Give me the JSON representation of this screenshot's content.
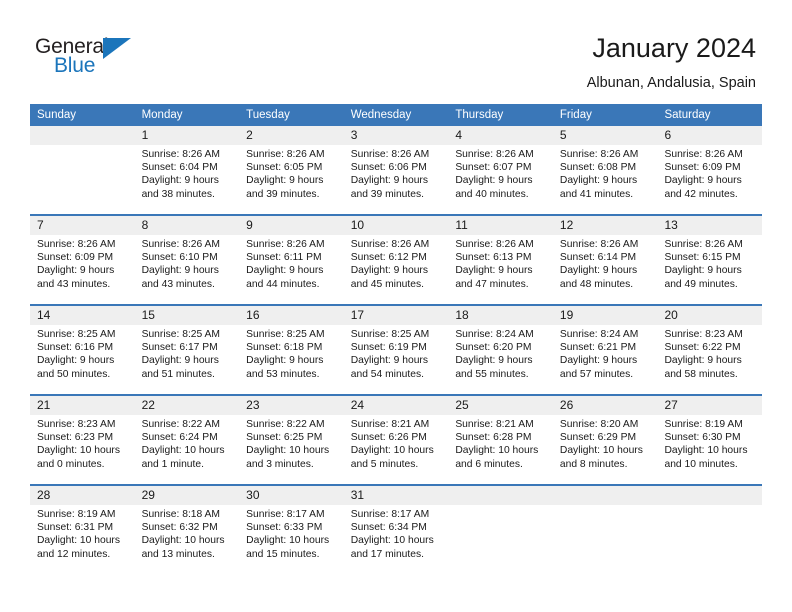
{
  "logo": {
    "text_top": "General",
    "text_bottom": "Blue",
    "triangle_icon": "blue-triangle-icon",
    "accent_color": "#1b75bb"
  },
  "header": {
    "title": "January 2024",
    "location": "Albunan, Andalusia, Spain"
  },
  "calendar": {
    "header_bg_color": "#3a77b8",
    "day_band_color": "#efefef",
    "weekdays": [
      "Sunday",
      "Monday",
      "Tuesday",
      "Wednesday",
      "Thursday",
      "Friday",
      "Saturday"
    ],
    "weeks": [
      [
        {
          "day": "",
          "lines": []
        },
        {
          "day": "1",
          "lines": [
            "Sunrise: 8:26 AM",
            "Sunset: 6:04 PM",
            "Daylight: 9 hours",
            "and 38 minutes."
          ]
        },
        {
          "day": "2",
          "lines": [
            "Sunrise: 8:26 AM",
            "Sunset: 6:05 PM",
            "Daylight: 9 hours",
            "and 39 minutes."
          ]
        },
        {
          "day": "3",
          "lines": [
            "Sunrise: 8:26 AM",
            "Sunset: 6:06 PM",
            "Daylight: 9 hours",
            "and 39 minutes."
          ]
        },
        {
          "day": "4",
          "lines": [
            "Sunrise: 8:26 AM",
            "Sunset: 6:07 PM",
            "Daylight: 9 hours",
            "and 40 minutes."
          ]
        },
        {
          "day": "5",
          "lines": [
            "Sunrise: 8:26 AM",
            "Sunset: 6:08 PM",
            "Daylight: 9 hours",
            "and 41 minutes."
          ]
        },
        {
          "day": "6",
          "lines": [
            "Sunrise: 8:26 AM",
            "Sunset: 6:09 PM",
            "Daylight: 9 hours",
            "and 42 minutes."
          ]
        }
      ],
      [
        {
          "day": "7",
          "lines": [
            "Sunrise: 8:26 AM",
            "Sunset: 6:09 PM",
            "Daylight: 9 hours",
            "and 43 minutes."
          ]
        },
        {
          "day": "8",
          "lines": [
            "Sunrise: 8:26 AM",
            "Sunset: 6:10 PM",
            "Daylight: 9 hours",
            "and 43 minutes."
          ]
        },
        {
          "day": "9",
          "lines": [
            "Sunrise: 8:26 AM",
            "Sunset: 6:11 PM",
            "Daylight: 9 hours",
            "and 44 minutes."
          ]
        },
        {
          "day": "10",
          "lines": [
            "Sunrise: 8:26 AM",
            "Sunset: 6:12 PM",
            "Daylight: 9 hours",
            "and 45 minutes."
          ]
        },
        {
          "day": "11",
          "lines": [
            "Sunrise: 8:26 AM",
            "Sunset: 6:13 PM",
            "Daylight: 9 hours",
            "and 47 minutes."
          ]
        },
        {
          "day": "12",
          "lines": [
            "Sunrise: 8:26 AM",
            "Sunset: 6:14 PM",
            "Daylight: 9 hours",
            "and 48 minutes."
          ]
        },
        {
          "day": "13",
          "lines": [
            "Sunrise: 8:26 AM",
            "Sunset: 6:15 PM",
            "Daylight: 9 hours",
            "and 49 minutes."
          ]
        }
      ],
      [
        {
          "day": "14",
          "lines": [
            "Sunrise: 8:25 AM",
            "Sunset: 6:16 PM",
            "Daylight: 9 hours",
            "and 50 minutes."
          ]
        },
        {
          "day": "15",
          "lines": [
            "Sunrise: 8:25 AM",
            "Sunset: 6:17 PM",
            "Daylight: 9 hours",
            "and 51 minutes."
          ]
        },
        {
          "day": "16",
          "lines": [
            "Sunrise: 8:25 AM",
            "Sunset: 6:18 PM",
            "Daylight: 9 hours",
            "and 53 minutes."
          ]
        },
        {
          "day": "17",
          "lines": [
            "Sunrise: 8:25 AM",
            "Sunset: 6:19 PM",
            "Daylight: 9 hours",
            "and 54 minutes."
          ]
        },
        {
          "day": "18",
          "lines": [
            "Sunrise: 8:24 AM",
            "Sunset: 6:20 PM",
            "Daylight: 9 hours",
            "and 55 minutes."
          ]
        },
        {
          "day": "19",
          "lines": [
            "Sunrise: 8:24 AM",
            "Sunset: 6:21 PM",
            "Daylight: 9 hours",
            "and 57 minutes."
          ]
        },
        {
          "day": "20",
          "lines": [
            "Sunrise: 8:23 AM",
            "Sunset: 6:22 PM",
            "Daylight: 9 hours",
            "and 58 minutes."
          ]
        }
      ],
      [
        {
          "day": "21",
          "lines": [
            "Sunrise: 8:23 AM",
            "Sunset: 6:23 PM",
            "Daylight: 10 hours",
            "and 0 minutes."
          ]
        },
        {
          "day": "22",
          "lines": [
            "Sunrise: 8:22 AM",
            "Sunset: 6:24 PM",
            "Daylight: 10 hours",
            "and 1 minute."
          ]
        },
        {
          "day": "23",
          "lines": [
            "Sunrise: 8:22 AM",
            "Sunset: 6:25 PM",
            "Daylight: 10 hours",
            "and 3 minutes."
          ]
        },
        {
          "day": "24",
          "lines": [
            "Sunrise: 8:21 AM",
            "Sunset: 6:26 PM",
            "Daylight: 10 hours",
            "and 5 minutes."
          ]
        },
        {
          "day": "25",
          "lines": [
            "Sunrise: 8:21 AM",
            "Sunset: 6:28 PM",
            "Daylight: 10 hours",
            "and 6 minutes."
          ]
        },
        {
          "day": "26",
          "lines": [
            "Sunrise: 8:20 AM",
            "Sunset: 6:29 PM",
            "Daylight: 10 hours",
            "and 8 minutes."
          ]
        },
        {
          "day": "27",
          "lines": [
            "Sunrise: 8:19 AM",
            "Sunset: 6:30 PM",
            "Daylight: 10 hours",
            "and 10 minutes."
          ]
        }
      ],
      [
        {
          "day": "28",
          "lines": [
            "Sunrise: 8:19 AM",
            "Sunset: 6:31 PM",
            "Daylight: 10 hours",
            "and 12 minutes."
          ]
        },
        {
          "day": "29",
          "lines": [
            "Sunrise: 8:18 AM",
            "Sunset: 6:32 PM",
            "Daylight: 10 hours",
            "and 13 minutes."
          ]
        },
        {
          "day": "30",
          "lines": [
            "Sunrise: 8:17 AM",
            "Sunset: 6:33 PM",
            "Daylight: 10 hours",
            "and 15 minutes."
          ]
        },
        {
          "day": "31",
          "lines": [
            "Sunrise: 8:17 AM",
            "Sunset: 6:34 PM",
            "Daylight: 10 hours",
            "and 17 minutes."
          ]
        },
        {
          "day": "",
          "lines": []
        },
        {
          "day": "",
          "lines": []
        },
        {
          "day": "",
          "lines": []
        }
      ]
    ]
  }
}
